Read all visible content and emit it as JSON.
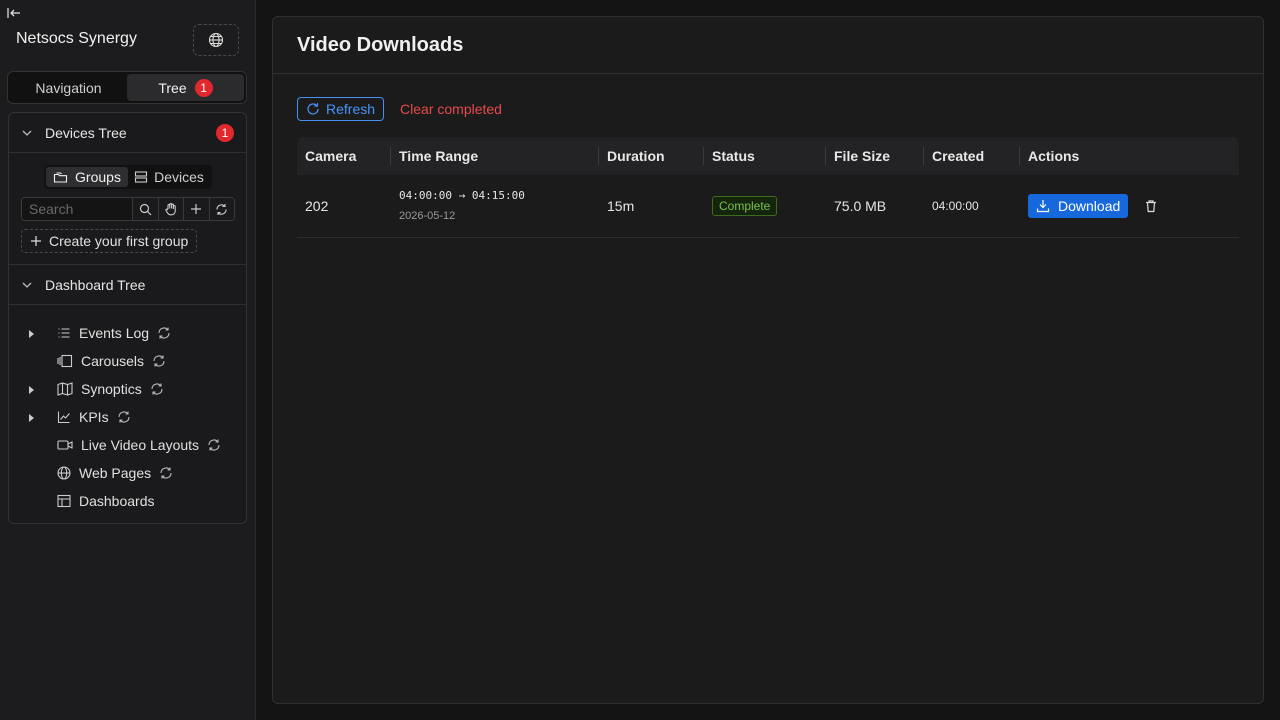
{
  "app": {
    "title": "Netsocs Synergy"
  },
  "sidebar": {
    "tabs": [
      {
        "label": "Navigation"
      },
      {
        "label": "Tree",
        "badge": "1"
      }
    ],
    "devices_tree": {
      "title": "Devices Tree",
      "badge": "1",
      "segment": [
        {
          "label": "Groups"
        },
        {
          "label": "Devices"
        }
      ],
      "search_placeholder": "Search",
      "create_group_label": "Create your first group"
    },
    "dashboard_tree": {
      "title": "Dashboard Tree",
      "items": [
        {
          "label": "Events Log",
          "icon": "list-icon",
          "expandable": true,
          "refresh": true
        },
        {
          "label": "Carousels",
          "icon": "carousel-icon",
          "expandable": false,
          "refresh": true
        },
        {
          "label": "Synoptics",
          "icon": "map-icon",
          "expandable": true,
          "refresh": true
        },
        {
          "label": "KPIs",
          "icon": "chart-line-icon",
          "expandable": true,
          "refresh": true
        },
        {
          "label": "Live Video Layouts",
          "icon": "video-camera-icon",
          "expandable": false,
          "refresh": true
        },
        {
          "label": "Web Pages",
          "icon": "globe-icon",
          "expandable": false,
          "refresh": true
        },
        {
          "label": "Dashboards",
          "icon": "table-icon",
          "expandable": false,
          "refresh": false
        }
      ]
    }
  },
  "main": {
    "title": "Video Downloads",
    "refresh_label": "Refresh",
    "clear_label": "Clear completed",
    "columns": [
      "Camera",
      "Time Range",
      "Duration",
      "Status",
      "File Size",
      "Created",
      "Actions"
    ],
    "rows": [
      {
        "camera": "202",
        "time_range": "04:00:00 → 04:15:00",
        "date": "2026-05-12",
        "duration": "15m",
        "status": "Complete",
        "file_size": "75.0 MB",
        "created": "04:00:00",
        "download_label": "Download"
      }
    ]
  },
  "colors": {
    "accent": "#1668dc",
    "danger": "#e84a4a",
    "success": "#79c24a",
    "badge": "#e0282e"
  }
}
